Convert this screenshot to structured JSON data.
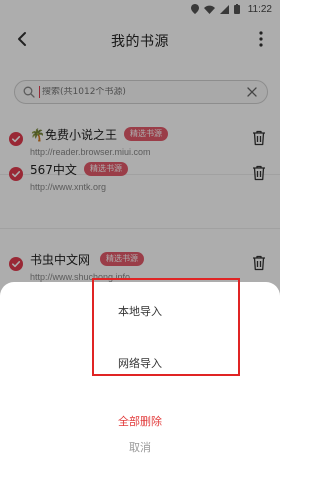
{
  "status_bar": {
    "time": "11:22"
  },
  "app_bar": {
    "title": "我的书源"
  },
  "search": {
    "placeholder": "搜索(共1012个书源)"
  },
  "sources": [
    {
      "name": "🌴免费小说之王",
      "tag": "精选书源",
      "url": "http://reader.browser.miui.com"
    },
    {
      "name": "567中文",
      "tag": "精选书源",
      "url": "http://www.xntk.org"
    },
    {
      "name": "书虫中文网",
      "tag": "精选书源",
      "url": "http://www.shuchong.info"
    }
  ],
  "sheet": {
    "local_import": "本地导入",
    "network_import": "网络导入",
    "delete_all": "全部删除",
    "cancel": "取消"
  },
  "colors": {
    "accent": "#e23b4e",
    "badge": "#e45a6a",
    "delete": "#e23b3b",
    "highlight_box": "#e02424"
  }
}
